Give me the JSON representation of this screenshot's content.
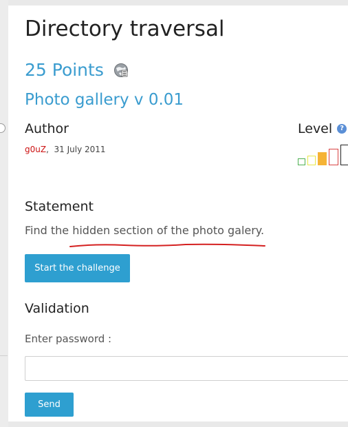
{
  "challenge": {
    "title": "Directory traversal",
    "points": "25 Points",
    "name": "Photo gallery v 0.01"
  },
  "author": {
    "heading": "Author",
    "name": "g0uZ",
    "separator": ",",
    "date": "31 July 2011"
  },
  "level": {
    "heading": "Level",
    "help_glyph": "?",
    "max": 5,
    "current": 3,
    "colors": [
      "#4caf50",
      "#e8e84a",
      "#f5b335",
      "#d94343",
      "#222222"
    ]
  },
  "statement": {
    "heading": "Statement",
    "text": "Find the hidden section of the photo galery.",
    "underline_color": "#d42020"
  },
  "actions": {
    "start_label": "Start the challenge",
    "send_label": "Send"
  },
  "validation": {
    "heading": "Validation",
    "password_label": "Enter password :",
    "password_value": ""
  },
  "colors": {
    "accent": "#3a9ccf",
    "button": "#2e9fd0",
    "author": "#cc1111"
  }
}
